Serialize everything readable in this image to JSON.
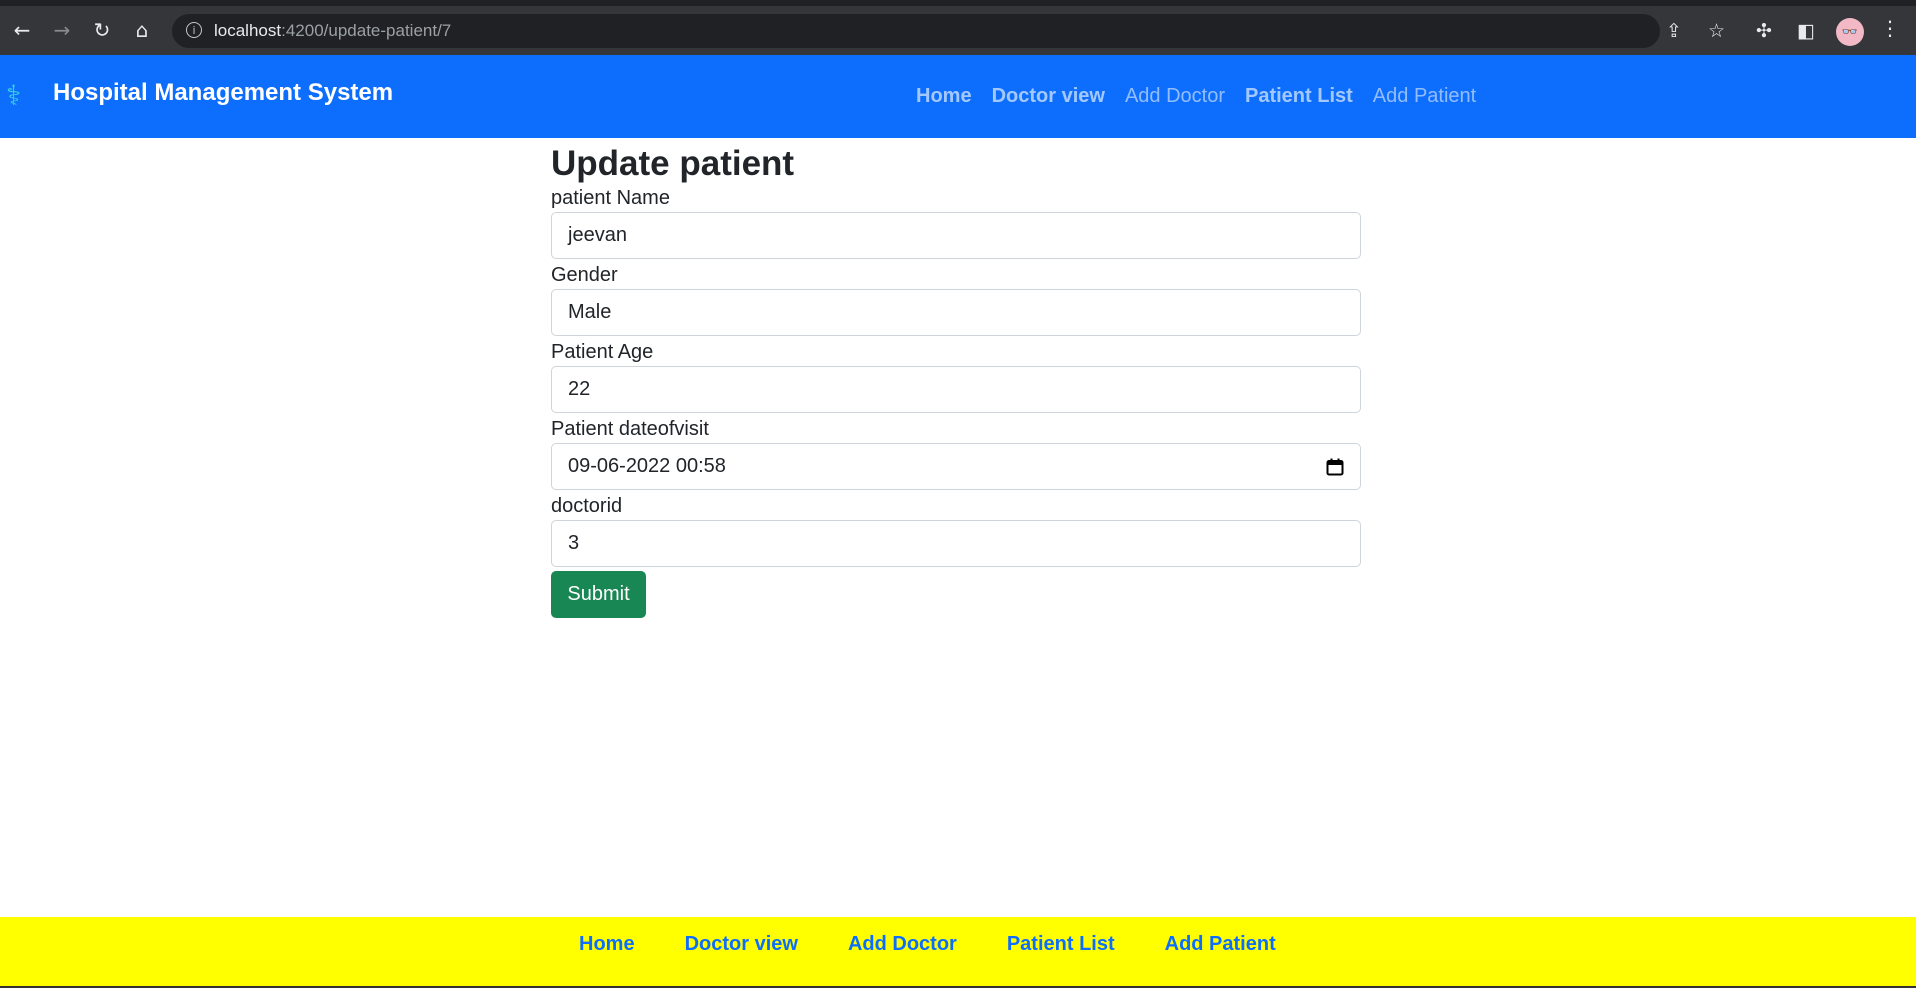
{
  "browser": {
    "url_host": "localhost",
    "url_path": ":4200/update-patient/7",
    "avatar": "👓"
  },
  "navbar": {
    "brand": "Hospital Management System",
    "links": [
      {
        "label": "Home"
      },
      {
        "label": "Doctor view"
      },
      {
        "label": "Add Doctor"
      },
      {
        "label": "Patient List"
      },
      {
        "label": "Add Patient"
      }
    ]
  },
  "form": {
    "title": "Update patient",
    "fields": [
      {
        "label": "patient Name",
        "value": "jeevan"
      },
      {
        "label": "Gender",
        "value": "Male"
      },
      {
        "label": "Patient Age",
        "value": "22"
      },
      {
        "label": "Patient dateofvisit",
        "value": "09-06-2022 00:58"
      },
      {
        "label": "doctorid",
        "value": "3"
      }
    ],
    "submit_label": "Submit"
  },
  "footer": {
    "links": [
      {
        "label": "Home"
      },
      {
        "label": "Doctor view"
      },
      {
        "label": "Add Doctor"
      },
      {
        "label": "Patient List"
      },
      {
        "label": "Add Patient"
      }
    ]
  },
  "colors": {
    "navbar": "#0d6efd",
    "footer": "#ffff00",
    "submit": "#198754"
  }
}
